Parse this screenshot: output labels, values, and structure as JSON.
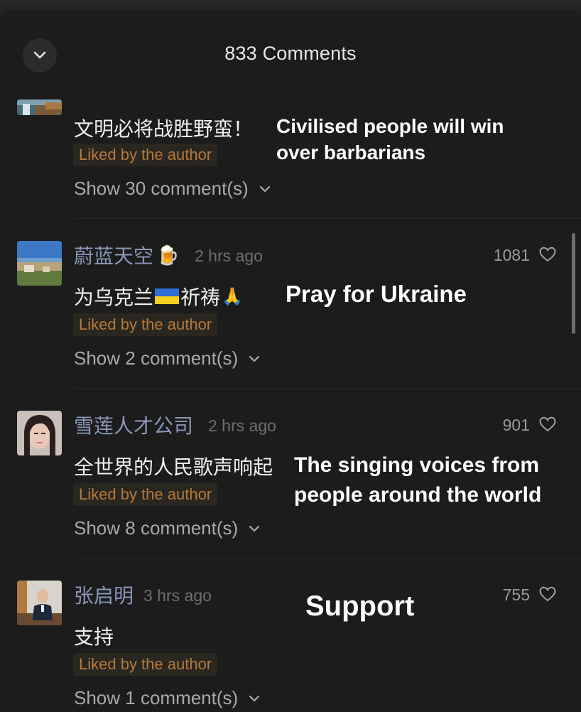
{
  "header": {
    "title": "833 Comments",
    "collapse_icon": "chevron-down-icon"
  },
  "comments": [
    {
      "text": "文明必将战胜野蛮！",
      "liked_label": "Liked by the author",
      "replies_label": "Show 30 comment(s)",
      "translation_line1": "Civilised people will win",
      "translation_line2": "over barbarians"
    },
    {
      "username": "蔚蓝天空",
      "username_emoji": "🍺",
      "time": "2 hrs ago",
      "likes": "1081",
      "text_before": "为乌克兰",
      "text_after": "祈祷",
      "text_emoji": "🙏",
      "liked_label": "Liked by the author",
      "replies_label": "Show 2 comment(s)",
      "translation_line1": "Pray for Ukraine"
    },
    {
      "username": "雪莲人才公司",
      "time": "2 hrs ago",
      "likes": "901",
      "text": "全世界的人民歌声响起",
      "liked_label": "Liked by the author",
      "replies_label": "Show 8 comment(s)",
      "translation_line1": "The singing voices from",
      "translation_line2": "people around the world"
    },
    {
      "username": "张启明",
      "time": "3 hrs ago",
      "likes": "755",
      "text": "支持",
      "liked_label": "Liked by the author",
      "replies_label": "Show 1 comment(s)",
      "translation_line1": "Support"
    }
  ],
  "colors": {
    "sheet_bg": "#1c1c1c",
    "username": "#8a97b8",
    "liked_badge_text": "#b5793c",
    "liked_badge_bg": "#2a2620"
  }
}
